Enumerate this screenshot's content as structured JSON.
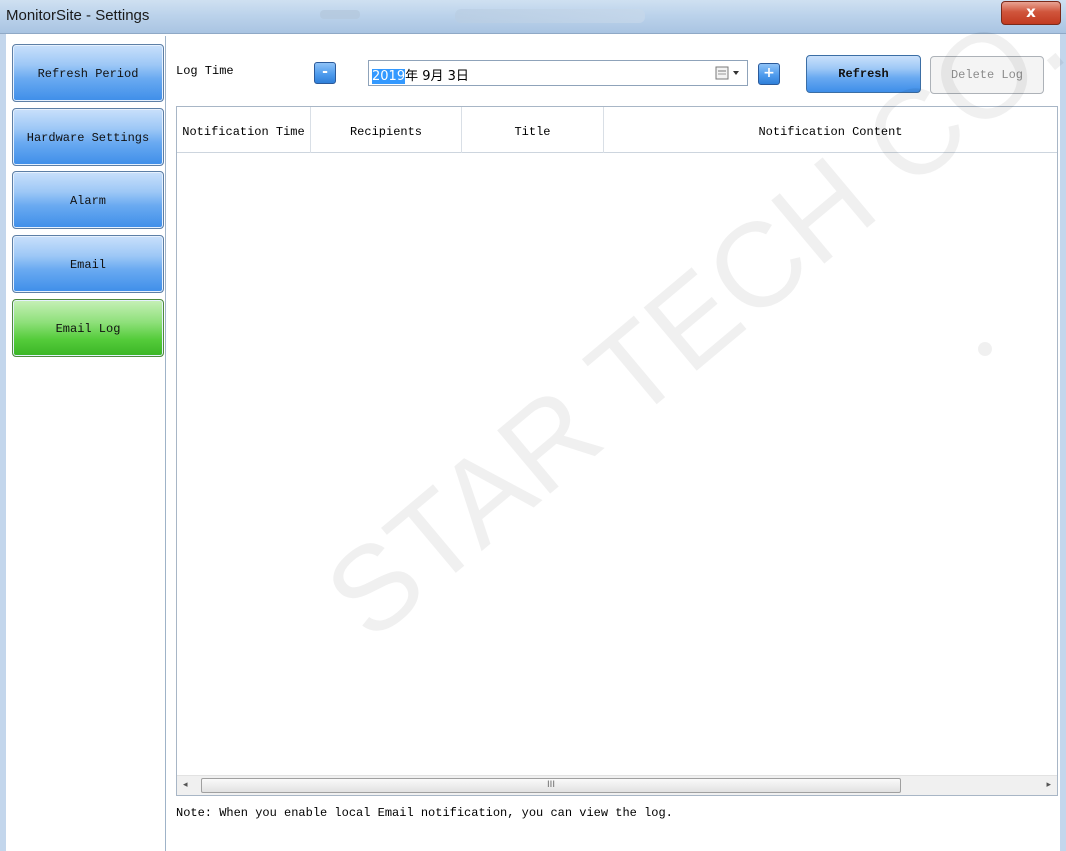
{
  "window": {
    "title": "MonitorSite - Settings",
    "close_label": "x"
  },
  "sidebar": {
    "items": [
      {
        "label": "Refresh Period"
      },
      {
        "label": "Hardware Settings"
      },
      {
        "label": "Alarm"
      },
      {
        "label": "Email"
      },
      {
        "label": "Email Log",
        "active": true
      }
    ]
  },
  "toolbar": {
    "log_time_label": "Log Time",
    "minus_label": "-",
    "plus_label": "+",
    "date": {
      "year": "2019",
      "rest": "年 9月 3日"
    },
    "refresh_label": "Refresh",
    "delete_label": "Delete Log"
  },
  "table": {
    "columns": [
      "Notification Time",
      "Recipients",
      "Title",
      "Notification Content"
    ],
    "rows": []
  },
  "scrollbar": {
    "left_arrow": "◂",
    "right_arrow": "▸",
    "grip": "III"
  },
  "note": "Note: When you enable local Email notification, you can view the log.",
  "watermark": "STAR TECH CO.,LTD.",
  "colors": {
    "accent_blue": "#4f9ced",
    "active_green": "#55cc3b",
    "close_red": "#c23a20"
  }
}
